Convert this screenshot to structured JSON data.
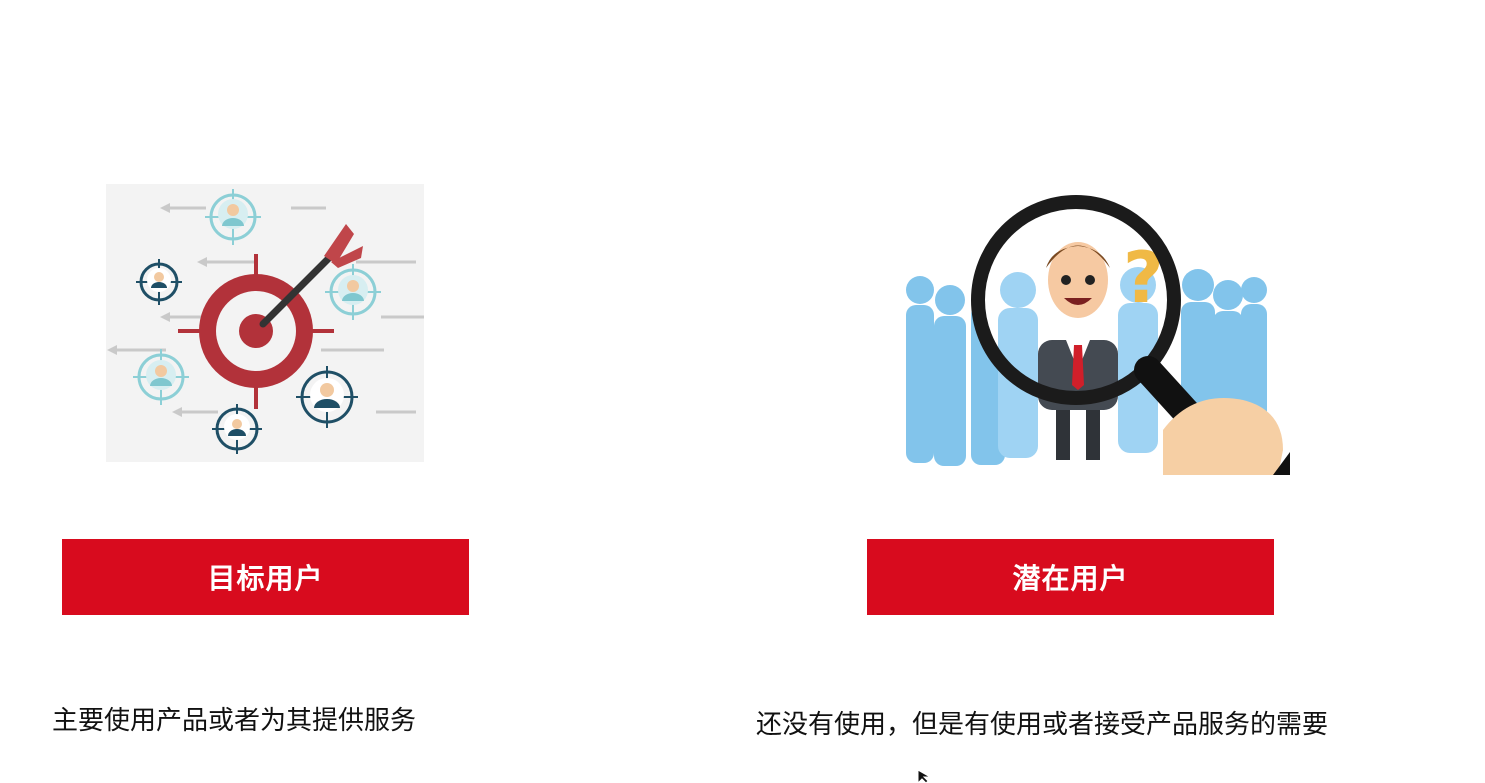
{
  "left_card": {
    "title": "目标用户",
    "description": "主要使用产品或者为其提供服务",
    "illustration": "target-users-icon"
  },
  "right_card": {
    "title": "潜在用户",
    "description": "还没有使用，但是有使用或者接受产品服务的需要",
    "illustration": "magnifier-crowd-icon"
  },
  "colors": {
    "accent": "#d80b1e",
    "text": "#111111",
    "target_red": "#b2323a",
    "crowd_blue": "#7cc1ea"
  }
}
